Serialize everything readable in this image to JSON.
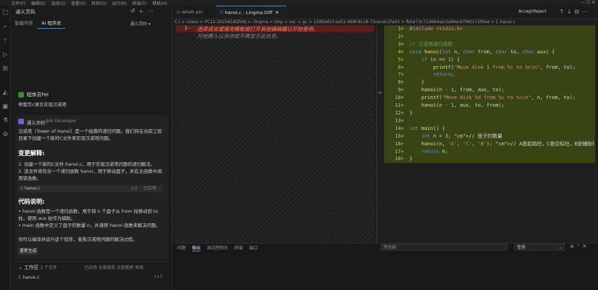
{
  "menubar": {
    "items": [
      "文件(F)",
      "编辑(E)",
      "选择(S)",
      "查看(V)",
      "转到(G)",
      "运行(R)",
      "终端(T)",
      "帮助(H)"
    ]
  },
  "side": {
    "title": "通义灵码",
    "tabs": [
      "智能问答",
      "AI 程序员"
    ],
    "model_label": "通义灵码 ▾",
    "user": {
      "name": "程序员Fei",
      "message": "帮我写c语言实现汉诺塔"
    },
    "ai": {
      "name": "通义灵码",
      "tag": "@AI Developer",
      "intro": "汉诺塔（Tower of Hanoi）是一个经典的递归问题。我们将在当前工程目录下创建一个新的C文件来实现汉诺塔问题。",
      "section1": "变更解释:",
      "steps": [
        "1. 创建一个新的C文件 hanoi.c，用于实现汉诺塔问题的递归解法。",
        "2. 该文件将包含一个递归函数 hanoi，用于移动盘子，并在主函数中调用该函数。"
      ],
      "file_chip": {
        "name": "hanoi.c",
        "count": "1/1",
        "action": "已应用"
      },
      "section2": "代码说明:",
      "bullets": [
        "• hanoi 函数是一个递归函数，用于将 n 个盘子从 from 柱移动到 to 柱，使用 aux 柱作为辅助。",
        "• main 函数中定义了盘子的数量 n，并调用 hanoi 函数来解决问题。"
      ],
      "closing": "你可以编译并运行这个程序，查看汉诺塔问题的解决过程。",
      "regen": "重新生成"
    },
    "workspace": {
      "title": "工作区",
      "meta": "1 个文件",
      "actions": "已应用  全部接受  全部拒绝  审阅",
      "file": "hanoi.c",
      "count": "+17"
    }
  },
  "editor": {
    "tabs": [
      {
        "label": "astab.yzc"
      },
      {
        "label": "hanoi.c - Lingma Diff"
      },
      {
        "label": "hanoi.c"
      }
    ],
    "accept_label": "Accept",
    "reject_label": "Reject",
    "breadcrumb": "C:\\ > Users > PC12-2025618IZHD > .lingma > tmp > vsc > gc > 1585b61f-ea52-468f-8c18-75cecdc1fa43 > fb5e73c7126b4a2cbd9ec67f40172f0ed > C hanoi.c",
    "left_line_number": "1",
    "left_line1": "选择语言或填充模板或打开其他编辑器以开始使用。",
    "left_line2": "开始键入以关闭或不再显示此信息。",
    "right_line_numbers": [
      "1+",
      "2+",
      "3+",
      "4+",
      "5+",
      "6+",
      "7+",
      "8+",
      "9+",
      "10+",
      "11+",
      "12+",
      "13+",
      "14+",
      "15+",
      "16+",
      "17+",
      "18+"
    ],
    "right_code_lines": [
      "#include <stdio.h>",
      "",
      "// 汉诺塔递归函数",
      "void hanoi(int n, char from, char to, char aux) {",
      "    if (n == 1) {",
      "        printf(\"Move disk 1 from %c to %c\\n\", from, to);",
      "        return;",
      "    }",
      "    hanoi(n - 1, from, aux, to);",
      "    printf(\"Move disk %d from %c to %c\\n\", n, from, to);",
      "    hanoi(n - 1, aux, to, from);",
      "}",
      "",
      "int main() {",
      "    int n = 3; // 盘子的数量",
      "    hanoi(n, 'A', 'C', 'B'); // A是起始柱，C是目标柱，B是辅助柱",
      "    return 0;",
      "}"
    ]
  },
  "panel": {
    "tabs": [
      "问题",
      "输出",
      "调试控制台",
      "终端",
      "端口"
    ],
    "active_tab": "输出",
    "filter_placeholder": "筛选器",
    "task_select": "任务"
  }
}
